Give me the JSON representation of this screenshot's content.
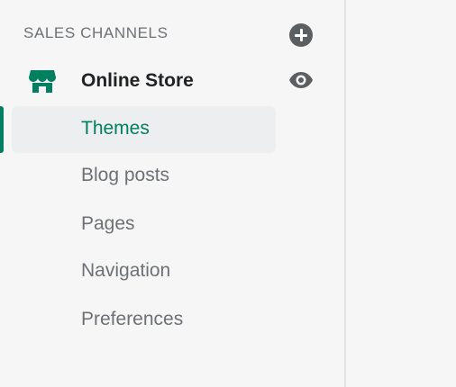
{
  "sidebar": {
    "section_header": "SALES CHANNELS",
    "add_icon": "plus-circle-icon",
    "channel": {
      "label": "Online Store",
      "icon": "store-icon",
      "view_icon": "eye-icon"
    },
    "sub_items": [
      {
        "label": "Themes",
        "active": true
      },
      {
        "label": "Blog posts",
        "active": false
      },
      {
        "label": "Pages",
        "active": false
      },
      {
        "label": "Navigation",
        "active": false
      },
      {
        "label": "Preferences",
        "active": false
      }
    ]
  },
  "colors": {
    "accent": "#008060",
    "active_text": "#007f5f",
    "muted_text": "#6d7175",
    "primary_text": "#202223",
    "icon_gray": "#5c5f62",
    "active_bg": "#edeeef"
  }
}
